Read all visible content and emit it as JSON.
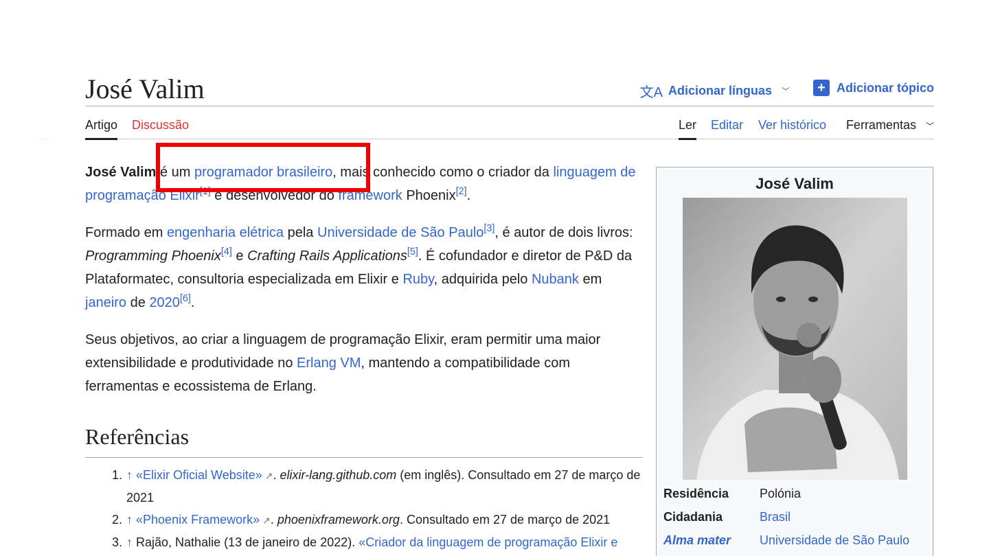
{
  "page": {
    "title": "José Valim",
    "add_languages": "Adicionar línguas",
    "add_topic": "Adicionar tópico"
  },
  "tabs": {
    "artigo": "Artigo",
    "discussao": "Discussão",
    "ler": "Ler",
    "editar": "Editar",
    "historico": "Ver histórico",
    "ferramentas": "Ferramentas"
  },
  "icons": {
    "translate": "translate-icon",
    "chevron": "chevron-down-icon",
    "add_topic": "plus-icon",
    "external": "external-link-icon"
  },
  "colors": {
    "link": "#3366cc",
    "red_link": "#dd3333",
    "highlight": "#ee0000"
  },
  "article": {
    "p1": {
      "bold": "José Valim",
      "t1": " é um ",
      "l1": "programador brasileiro",
      "t2": ", mais conhecido como o criador da ",
      "l2": "linguagem de programação Elixir",
      "r1": "[1]",
      "t3": " e desenvolvedor do ",
      "l3": "framework",
      "t4": " Phoenix",
      "r2": "[2]",
      "t5": "."
    },
    "p2": {
      "t1": "Formado em ",
      "l1": "engenharia elétrica",
      "t2": " pela ",
      "l2": "Universidade de São Paulo",
      "r3": "[3]",
      "t3": ", é autor de dois livros: ",
      "i1": "Programming Phoenix",
      "r4": "[4]",
      "t4": " e ",
      "i2": "Crafting Rails Applications",
      "r5": "[5]",
      "t5": ". É cofundador e diretor de P&D da Plataformatec, consultoria especializada em Elixir e ",
      "l3": "Ruby",
      "t6": ", adquirida pelo ",
      "l4": "Nubank",
      "t7": " em ",
      "l5": "janeiro",
      "t8": " de ",
      "l6": "2020",
      "r6": "[6]",
      "t9": "."
    },
    "p3": {
      "t1": "Seus objetivos, ao criar a linguagem de programação Elixir, eram permitir uma maior extensibilidade e produtividade no ",
      "l1": "Erlang VM",
      "t2": ", mantendo a compatibilidade com ferramentas e ecossistema de Erlang."
    }
  },
  "references": {
    "heading": "Referências",
    "items": [
      {
        "num": "1.",
        "arrow": "↑",
        "link": "«Elixir Oficial Website»",
        "site": "elixir-lang.github.com",
        "rest": " (em inglês). Consultado em 27 de março de 2021"
      },
      {
        "num": "2.",
        "arrow": "↑",
        "link": "«Phoenix Framework»",
        "site": "phoenixframework.org",
        "rest": ". Consultado em 27 de março de 2021"
      },
      {
        "num": "3.",
        "arrow": "↑",
        "pre": "Rajão, Nathalie (13 de janeiro de 2022). ",
        "link": "«Criador da linguagem de programação Elixir e"
      }
    ]
  },
  "infobox": {
    "title": "José Valim",
    "rows": [
      {
        "key": "Residência",
        "value": "Polónia"
      },
      {
        "key": "Cidadania",
        "value": "Brasil"
      },
      {
        "key": "Alma mater",
        "value": "Universidade de São Paulo"
      }
    ]
  }
}
